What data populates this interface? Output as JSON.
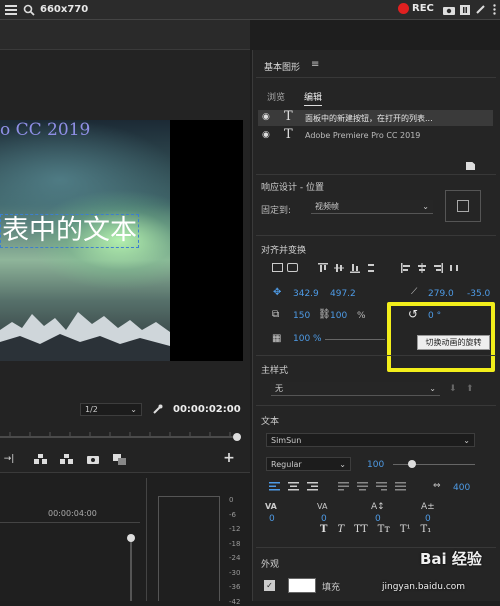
{
  "capture_bar": {
    "size_label": "660x770",
    "rec_label": "REC"
  },
  "viewer": {
    "overlay_line1": "o CC 2019",
    "overlay_line2": "表中的文本",
    "zoom_select": "1/2",
    "timecode": "00:00:02:00",
    "ruler_timecode": "00:00:04:00",
    "meter_ticks": [
      "0",
      "-6",
      "-12",
      "-18",
      "-24",
      "-30",
      "-36",
      "-42"
    ]
  },
  "panel": {
    "title": "基本图形",
    "tabs": [
      {
        "label": "浏览"
      },
      {
        "label": "编辑"
      }
    ],
    "layers": [
      {
        "name": "面板中的新建按钮，在打开的列表..."
      },
      {
        "name": "Adobe Premiere Pro CC 2019"
      }
    ],
    "responsive": {
      "heading": "响应设计 - 位置",
      "pin_label": "固定到:",
      "pin_value": "视频帧"
    },
    "align": {
      "heading": "对齐并变换",
      "pos_x": "342.9",
      "pos_y": "497.2",
      "anchor_x": "279.0",
      "anchor_y": "-35.0",
      "scale": "150",
      "scale_pct": "100",
      "pct_sign": "%",
      "rotation": "0 °",
      "opacity": "100 %",
      "tooltip": "切换动画的旋转"
    },
    "master_style": {
      "heading": "主样式",
      "value": "无"
    },
    "text": {
      "heading": "文本",
      "font": "SimSun",
      "style": "Regular",
      "size": "100",
      "tracking": "400",
      "kerning": "0",
      "leading": "0",
      "baseline": "0",
      "tsume": "0",
      "styles": [
        "T",
        "T",
        "TT",
        "Tт",
        "T¹",
        "T₁"
      ]
    },
    "appearance": {
      "heading": "外观",
      "fill_label": "填充",
      "fill_color": "#ffffff"
    }
  },
  "watermark": {
    "line1": "Bai 经验",
    "line2": "jingyan.baidu.com"
  },
  "colors": {
    "highlight": "#f2ee1b",
    "accent": "#4e9be6",
    "rec": "#e02020"
  }
}
